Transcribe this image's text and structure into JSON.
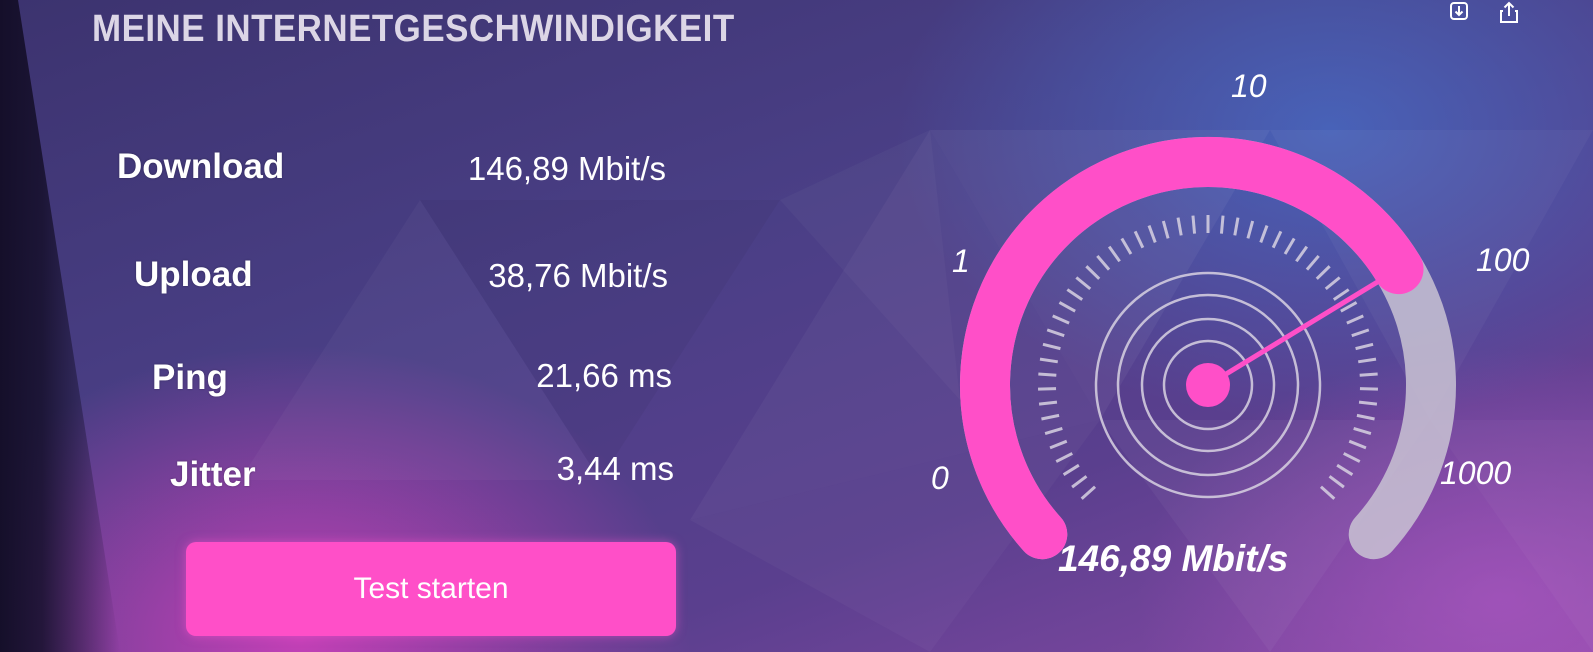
{
  "title": "MEINE INTERNETGESCHWINDIGKEIT",
  "metrics": [
    {
      "label": "Download",
      "value": "146,89 Mbit/s"
    },
    {
      "label": "Upload",
      "value": "38,76 Mbit/s"
    },
    {
      "label": "Ping",
      "value": "21,66 ms"
    },
    {
      "label": "Jitter",
      "value": "3,44 ms"
    }
  ],
  "button_label": "Test starten",
  "gauge": {
    "scale_labels": [
      "0",
      "1",
      "10",
      "100",
      "1000"
    ],
    "scale": "log",
    "min": 1,
    "max": 1000,
    "current_mbits": 146.89,
    "value_text": "146,89 Mbit/s",
    "fill_color": "#ff4fc8",
    "track_color": "#c9c3d3"
  },
  "top_icons": [
    "download-icon",
    "share-icon"
  ]
}
